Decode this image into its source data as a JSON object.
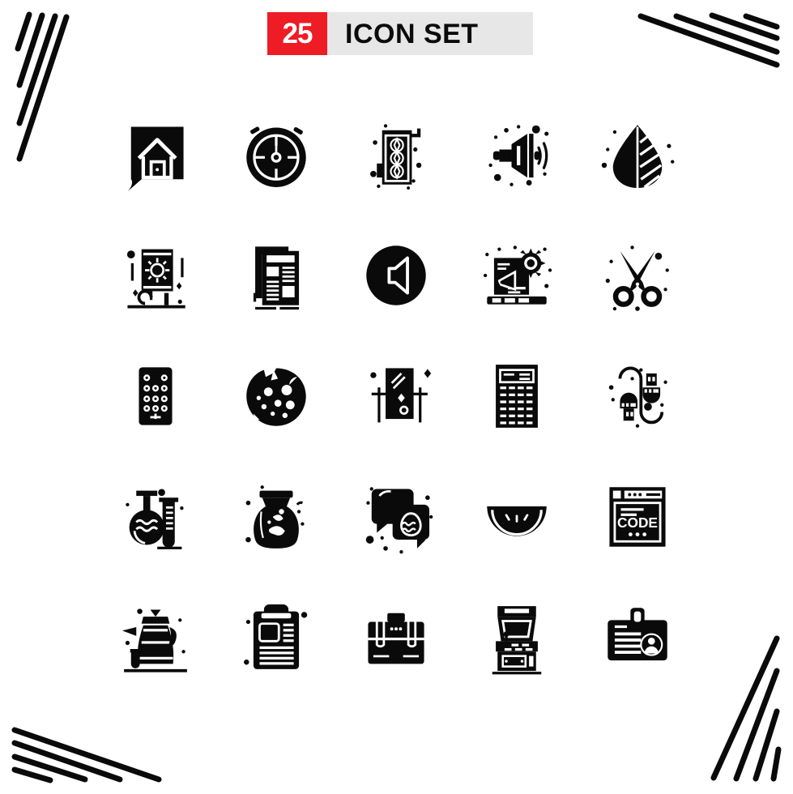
{
  "header": {
    "count": "25",
    "title": "ICON SET",
    "badge_color": "#EE1C25",
    "bar_color": "#E7E7E7",
    "text_color": "#0b0b0b"
  },
  "decorations": {
    "top_left": "diagonal-stripes-decoration",
    "top_right": "diagonal-stripes-decoration",
    "bottom_left": "diagonal-stripes-decoration",
    "bottom_right": "diagonal-stripes-decoration",
    "stripe_count": 4,
    "stripe_color": "#0a0a0a"
  },
  "grid": {
    "rows": 5,
    "columns": 5,
    "total": 25,
    "icon_color": "#0a0a0a"
  },
  "icons": [
    {
      "index": 1,
      "name": "home-chat-icon",
      "label": "Home Chat"
    },
    {
      "index": 2,
      "name": "stopwatch-icon",
      "label": "Stopwatch"
    },
    {
      "index": 3,
      "name": "graphics-card-icon",
      "label": "Graphics Card"
    },
    {
      "index": 4,
      "name": "megaphone-sound-icon",
      "label": "Megaphone"
    },
    {
      "index": 5,
      "name": "leaf-drop-icon",
      "label": "Leaf Drop"
    },
    {
      "index": 6,
      "name": "solar-panel-icon",
      "label": "Solar Panel"
    },
    {
      "index": 7,
      "name": "newspaper-icon",
      "label": "Newspaper"
    },
    {
      "index": 8,
      "name": "speaker-circle-icon",
      "label": "Speaker"
    },
    {
      "index": 9,
      "name": "laptop-marketing-icon",
      "label": "Laptop Marketing"
    },
    {
      "index": 10,
      "name": "scissors-icon",
      "label": "Scissors"
    },
    {
      "index": 11,
      "name": "remote-keypad-icon",
      "label": "Remote Keypad"
    },
    {
      "index": 12,
      "name": "cookie-icon",
      "label": "Cookie"
    },
    {
      "index": 13,
      "name": "mirror-glass-icon",
      "label": "Mirror Glass"
    },
    {
      "index": 14,
      "name": "calculator-icon",
      "label": "Calculator"
    },
    {
      "index": 15,
      "name": "usb-cable-icon",
      "label": "USB Cable"
    },
    {
      "index": 16,
      "name": "lab-flask-icon",
      "label": "Lab Flask"
    },
    {
      "index": 17,
      "name": "jar-vase-icon",
      "label": "Jar"
    },
    {
      "index": 18,
      "name": "easter-egg-chat-icon",
      "label": "Easter Egg Chat"
    },
    {
      "index": 19,
      "name": "watermelon-icon",
      "label": "Watermelon"
    },
    {
      "index": 20,
      "name": "code-browser-icon",
      "label": "Code Browser",
      "text": "CODE"
    },
    {
      "index": 21,
      "name": "coffee-pot-icon",
      "label": "Coffee Pot"
    },
    {
      "index": 22,
      "name": "clipboard-icon",
      "label": "Clipboard"
    },
    {
      "index": 23,
      "name": "briefcase-icon",
      "label": "Briefcase"
    },
    {
      "index": 24,
      "name": "arcade-machine-icon",
      "label": "Arcade Machine"
    },
    {
      "index": 25,
      "name": "id-badge-icon",
      "label": "ID Badge"
    }
  ]
}
